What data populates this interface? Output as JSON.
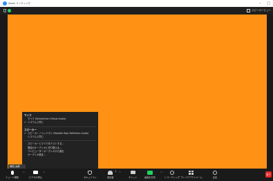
{
  "window": {
    "title": "Zoom ミーティング",
    "minimize": "–",
    "maximize": "□"
  },
  "topbar": {
    "view_label": "スピーカービュー"
  },
  "name_tag": "岡田 太郎",
  "audio_menu": {
    "mic_header": "マイク",
    "mic_items": [
      {
        "label": "マイク (StreamCam Virtual Audio)",
        "checked": false
      },
      {
        "label": "システムと同じ",
        "checked": true
      }
    ],
    "speaker_header": "スピーカー",
    "speaker_items": [
      {
        "label": "スピーカー / ヘッドホン (Realtek High Definition Audio)",
        "checked": true
      },
      {
        "label": "システムと同じ",
        "checked": false
      }
    ],
    "actions": [
      "スピーカーとマイクをテストする...",
      "電話のオーディオに切り替える...",
      "コンピューターオーディオから退出",
      "オーディオ設定..."
    ]
  },
  "toolbar": {
    "mute": "ミュート解除",
    "video": "ビデオの停止",
    "security": "セキュリティ",
    "participants": "参加者",
    "participant_count": "1",
    "chat": "チャット",
    "share": "画面を共有",
    "record": "レコーディング",
    "breakout": "ブレイクアウトルーム",
    "reactions": "反応",
    "end": "終了"
  },
  "colors": {
    "video_bg": "#ff9214",
    "share_accent": "#23d160",
    "end_red": "#e02828"
  }
}
